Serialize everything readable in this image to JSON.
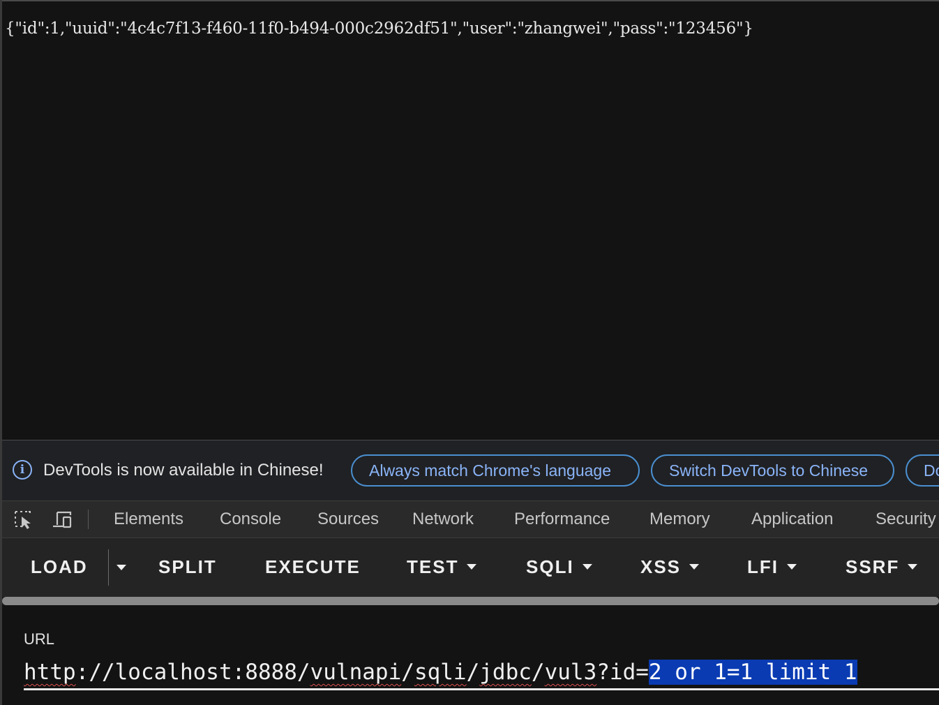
{
  "page": {
    "json_response": "{\"id\":1,\"uuid\":\"4c4c7f13-f460-11f0-b494-000c2962df51\",\"user\":\"zhangwei\",\"pass\":\"123456\"}"
  },
  "devtools": {
    "infobar": {
      "icon": "info-icon",
      "message": "DevTools is now available in Chinese!",
      "buttons": [
        "Always match Chrome's language",
        "Switch DevTools to Chinese",
        "Do"
      ]
    },
    "toolbar_icons": [
      "inspect-element-icon",
      "device-toolbar-icon"
    ],
    "tabs": [
      "Elements",
      "Console",
      "Sources",
      "Network",
      "Performance",
      "Memory",
      "Application",
      "Security"
    ]
  },
  "hackbar": {
    "buttons": [
      {
        "label": "LOAD",
        "dropdown": false
      },
      {
        "label": "SPLIT",
        "dropdown": false
      },
      {
        "label": "EXECUTE",
        "dropdown": false
      },
      {
        "label": "TEST",
        "dropdown": true
      },
      {
        "label": "SQLI",
        "dropdown": true
      },
      {
        "label": "XSS",
        "dropdown": true
      },
      {
        "label": "LFI",
        "dropdown": true
      },
      {
        "label": "SSRF",
        "dropdown": true
      }
    ],
    "url_label": "URL",
    "url_value": "http://localhost:8888/vulnapi/sqli/jdbc/vul3?id=2 or 1=1 limit 1",
    "url_parts": {
      "w1": "http",
      "s1": "://localhost:8888/",
      "w2": "vulnapi",
      "s2": "/",
      "w3": "sqli",
      "s3": "/",
      "w4": "jdbc",
      "s4": "/",
      "w5": "vul3",
      "s5": "?id=",
      "selected": "2 or 1=1 limit 1"
    }
  },
  "colors": {
    "background": "#131313",
    "link_blue": "#8ab4f8",
    "selection": "#0a3bb3"
  }
}
